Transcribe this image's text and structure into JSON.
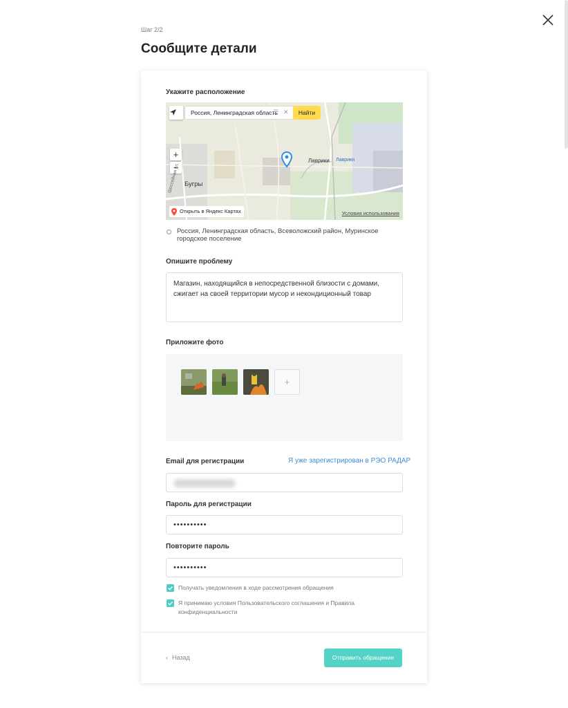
{
  "header": {
    "step": "Шаг 2/2",
    "title": "Сообщите детали"
  },
  "location": {
    "label": "Укажите расположение",
    "map": {
      "search_value": "Россия, Ленинградская область",
      "search_button": "Найти",
      "open_link": "Открыть в Яндекс Картах",
      "terms": "Условия использования",
      "place_labels": [
        "Бугры",
        "Лаврики",
        "Лаврики",
        "Шоссейная ул."
      ]
    },
    "address": "Россия, Ленинградская область, Всеволожский район, Муринское городское поселение"
  },
  "problem": {
    "label": "Опишите проблему",
    "value": "Магазин, находящийся в непосредственной близости с домами, сжигает на своей территории мусор и некондиционный товар"
  },
  "photos": {
    "label": "Приложите фото",
    "add_label": "+"
  },
  "registration": {
    "email_label": "Email для регистрации",
    "already_registered": "Я уже зарегистрирован в РЭО РАДАР",
    "password_label": "Пароль для регистрации",
    "password_value": "••••••••••",
    "repeat_label": "Повторите пароль",
    "repeat_value": "••••••••••"
  },
  "consents": [
    {
      "label": "Получать уведомления в ходе рассмотрения обращения",
      "checked": true
    },
    {
      "label": "Я принимаю условия Пользовательского соглашения и Правила конфиденциальности",
      "checked": true
    }
  ],
  "footer": {
    "back": "Назад",
    "submit": "Отправить обращение"
  },
  "colors": {
    "accent": "#52d3c5",
    "link": "#3b8ed8",
    "map_search_button": "#ffdb4d"
  }
}
